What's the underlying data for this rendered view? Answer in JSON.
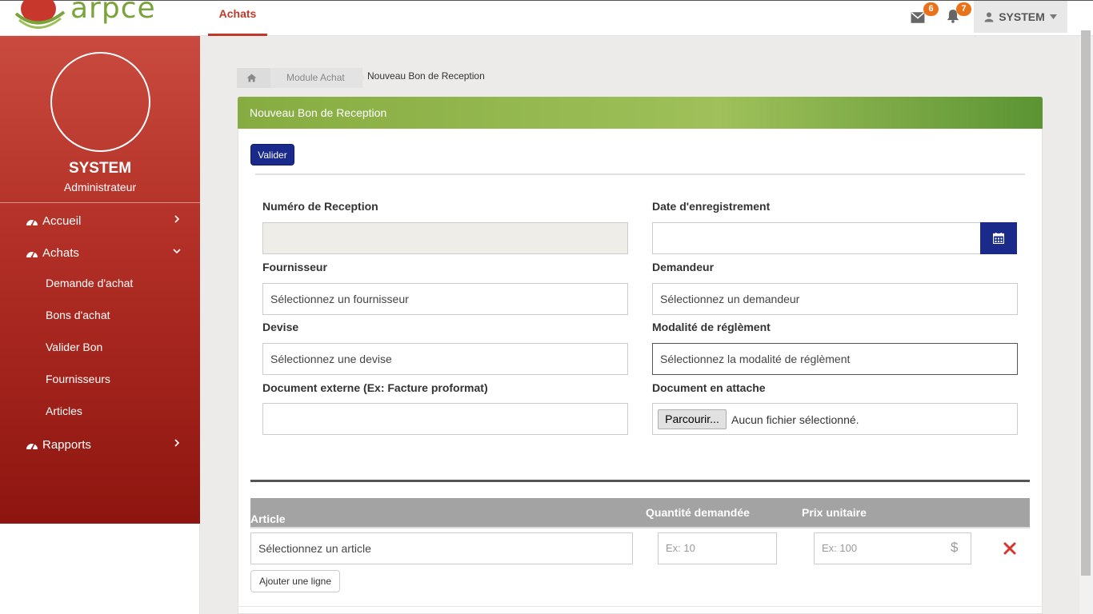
{
  "header": {
    "logo_text": "arpce",
    "active_tab": "Achats",
    "messages_count": "6",
    "notifications_count": "7",
    "user_menu_label": "SYSTEM",
    "icons": {
      "mail": "envelope-icon",
      "bell": "bell-icon",
      "user": "user-icon",
      "caret": "caret-down-icon"
    }
  },
  "sidebar": {
    "user_name": "SYSTEM",
    "user_role": "Administrateur",
    "menu": [
      {
        "label": "Accueil",
        "icon": "dashboard-icon",
        "chevron": "chevron-right-icon"
      },
      {
        "label": "Achats",
        "icon": "dashboard-icon",
        "chevron": "chevron-down-icon"
      },
      {
        "label": "Rapports",
        "icon": "dashboard-icon",
        "chevron": "chevron-right-icon"
      }
    ],
    "submenu": [
      "Demande d'achat",
      "Bons d'achat",
      "Valider Bon",
      "Fournisseurs",
      "Articles"
    ]
  },
  "breadcrumb": {
    "home_icon": "home-icon",
    "module": "Module Achat",
    "current": "Nouveau Bon de Reception"
  },
  "panel": {
    "title": "Nouveau Bon de Reception",
    "valider_label": "Valider"
  },
  "form": {
    "numero_label": "Numéro de Reception",
    "numero_value": "",
    "date_label": "Date d'enregistrement",
    "date_value": "",
    "fournisseur_label": "Fournisseur",
    "fournisseur_value": "Sélectionnez un fournisseur",
    "demandeur_label": "Demandeur",
    "demandeur_value": "Sélectionnez un demandeur",
    "devise_label": "Devise",
    "devise_value": "Sélectionnez une devise",
    "modalite_label": "Modalité de réglèment",
    "modalite_value": "Sélectionnez la modalité de réglèment",
    "doc_externe_label": "Document externe (Ex: Facture proformat)",
    "doc_externe_value": "",
    "doc_attache_label": "Document en attache",
    "browse_label": "Parcourir...",
    "no_file_text": "Aucun fichier sélectionné."
  },
  "table": {
    "headers": [
      "Article",
      "Quantité demandée",
      "Prix unitaire"
    ],
    "row": {
      "article_value": "Sélectionnez un article",
      "quantite_placeholder": "Ex: 10",
      "prix_placeholder": "Ex: 100",
      "currency_symbol": "$"
    },
    "add_line_label": "Ajouter une ligne"
  },
  "colors": {
    "sidebar_top": "#c94a3e",
    "sidebar_bottom": "#8e1510",
    "panel_header": "#86ac41",
    "primary_button": "#1a2a8a",
    "badge": "#e8731a",
    "delete": "#d9342b"
  }
}
